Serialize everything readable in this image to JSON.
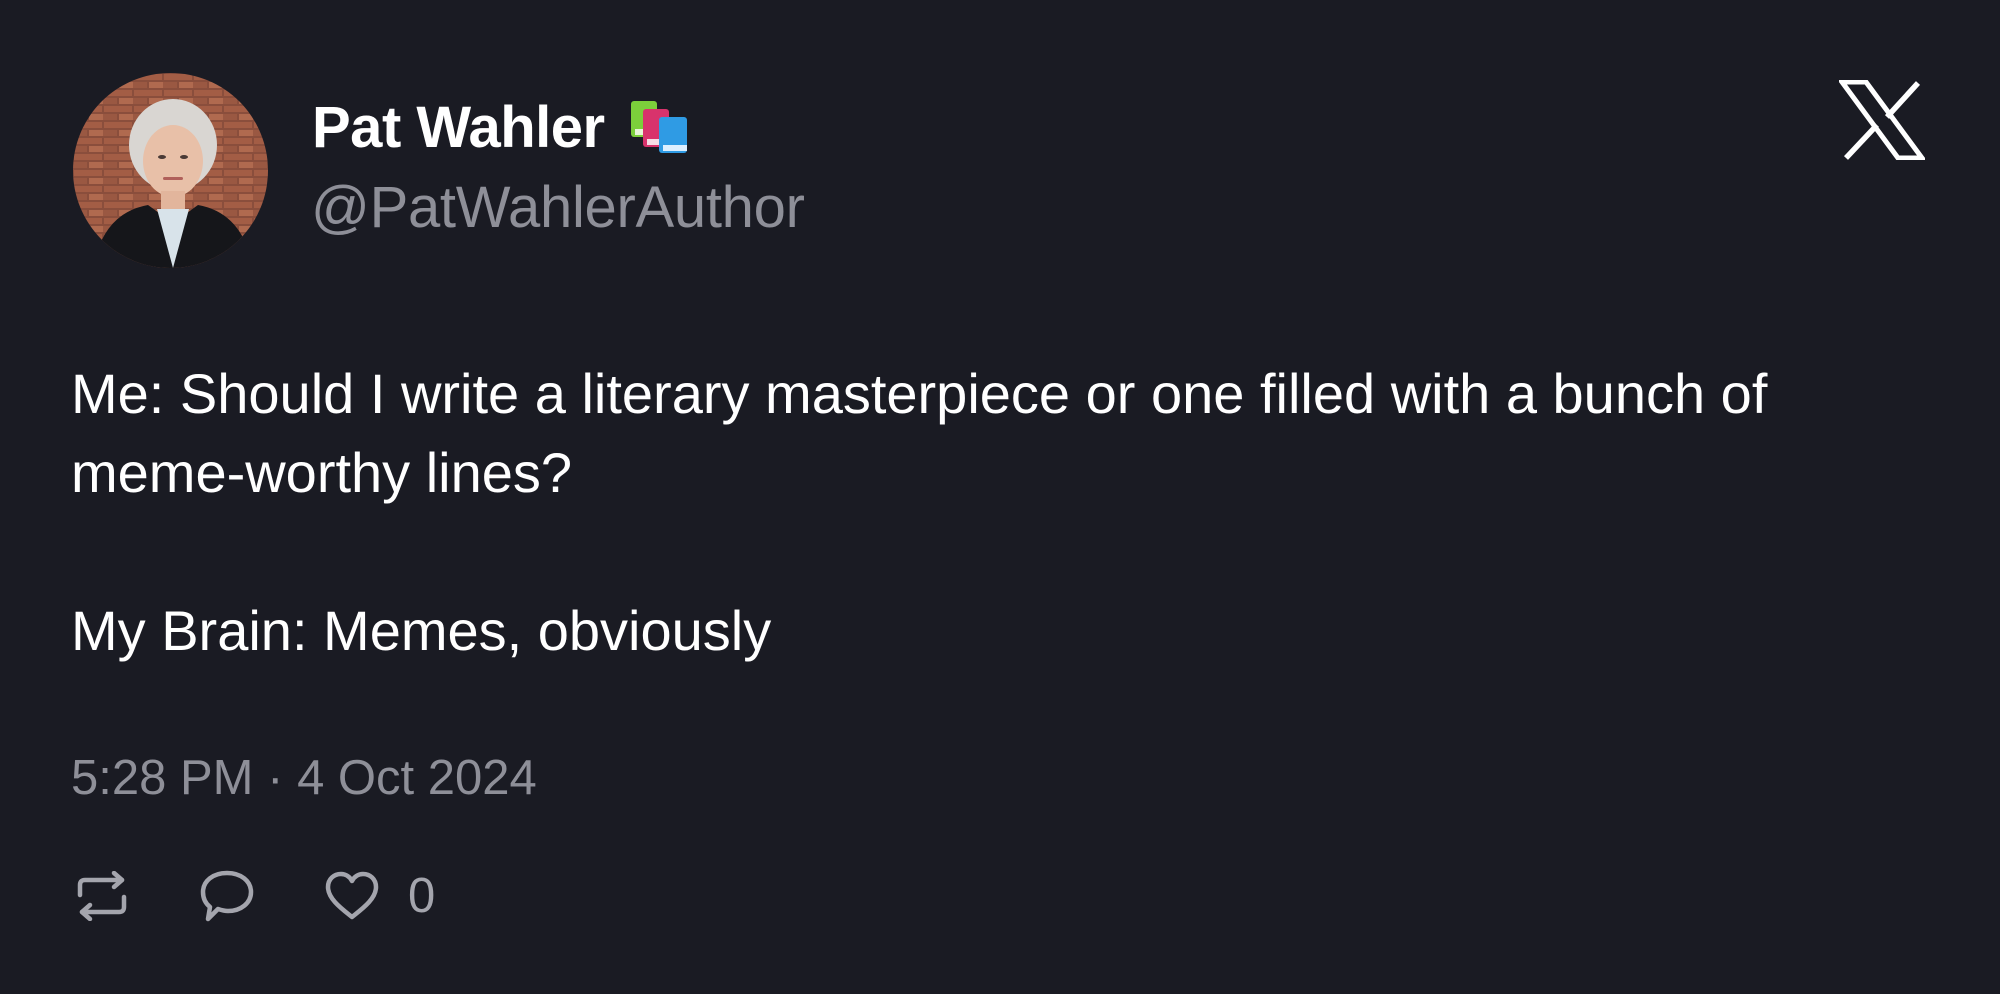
{
  "author": {
    "display_name": "Pat Wahler",
    "name_emoji": "books-emoji",
    "handle": "@PatWahlerAuthor",
    "avatar": "avatar-photo"
  },
  "brand_icon": "x-logo-icon",
  "tweet": {
    "paragraphs": [
      "Me: Should I write a literary masterpiece or one filled with a bunch of meme-worthy lines?",
      "My Brain: Memes, obviously"
    ]
  },
  "meta": {
    "time": "5:28 PM",
    "separator": "·",
    "date": "4 Oct 2024"
  },
  "actions": {
    "retweet_icon": "retweet-icon",
    "reply_icon": "reply-icon",
    "like_icon": "heart-icon",
    "like_count": "0"
  },
  "colors": {
    "background": "#1a1b23",
    "primary_text": "#ffffff",
    "secondary_text": "#8e8f98"
  }
}
